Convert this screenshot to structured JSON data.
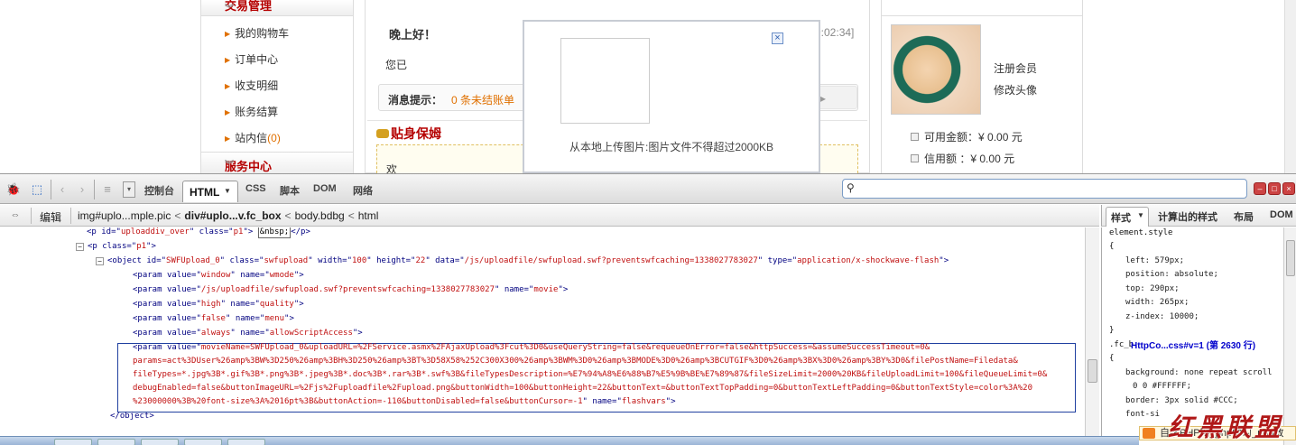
{
  "page": {
    "left_menu": {
      "section_title": "交易管理",
      "items": [
        {
          "label": "我的购物车"
        },
        {
          "label": "订单中心"
        },
        {
          "label": "收支明细"
        },
        {
          "label": "账务结算"
        },
        {
          "label": "站内信",
          "count": "(0)"
        }
      ],
      "service_title": "服务中心"
    },
    "center": {
      "greeting": "晚上好！",
      "time": "9:02:34]",
      "uploaded_text": "您已",
      "notice_label": "消息提示：",
      "notice_value": "0 条未结账单",
      "nanny_title": "贴身保姆",
      "nanny_text": "欢"
    },
    "right_panel": {
      "register_link": "注册会员",
      "edit_avatar_link": "修改头像",
      "available_label": "可用金额：",
      "available_value": "¥ 0.00 元",
      "credit_label": "信用额",
      "credit_sep": "：",
      "credit_value": "¥ 0.00 元"
    },
    "popup": {
      "hint": "从本地上传图片:图片文件不得超过2000KB",
      "close_icon": "close-icon"
    }
  },
  "devtools": {
    "tabs": [
      "控制台",
      "HTML",
      "CSS",
      "脚本",
      "DOM",
      "网络"
    ],
    "edit_label": "编辑",
    "breadcrumbs": [
      "img#uplo...mple.pic",
      "div#uplo...v.fc_box",
      "body.bdbg",
      "html"
    ],
    "side_tabs": [
      "样式",
      "计算出的样式",
      "布局",
      "DOM"
    ],
    "html_lines": {
      "l1_id": "uploaddiv_over",
      "l1_class": "p1",
      "l1_text": "&nbsp;",
      "l2_class": "p1",
      "obj_id": "SWFUpload_0",
      "obj_class": "swfupload",
      "obj_width": "100",
      "obj_height": "22",
      "obj_data": "/js/uploadfile/swfupload.swf?preventswfcaching=1338027783027",
      "obj_type": "application/x-shockwave-flash",
      "p1_value": "window",
      "p1_name": "wmode",
      "p2_value": "/js/uploadfile/swfupload.swf?preventswfcaching=1338027783027",
      "p2_name": "movie",
      "p3_value": "high",
      "p3_name": "quality",
      "p4_value": "false",
      "p4_name": "menu",
      "p5_value": "always",
      "p5_name": "allowScriptAccess",
      "p6_value_1": "movieName=SWFUpload_0&uploadURL=%2FService.asmx%2FAjaxUpload%3Fcut%3D0&useQueryString=false&requeueOnError=false&httpSuccess=&assumeSuccessTimeout=0&",
      "p6_value_2": "params=act%3DUser%26amp%3BW%3D250%26amp%3BH%3D250%26amp%3BT%3D58X58%252C300X300%26amp%3BWM%3D0%26amp%3BMODE%3D0%26amp%3BCUTGIF%3D0%26amp%3BX%3D0%26amp%3BY%3D0&filePostName=Filedata&",
      "p6_value_3": "fileTypes=*.jpg%3B*.gif%3B*.png%3B*.jpeg%3B*.doc%3B*.rar%3B*.swf%3B&fileTypesDescription=%E7%94%A8%E6%88%B7%E5%9B%BE%E7%89%87&fileSizeLimit=2000%20KB&fileUploadLimit=100&fileQueueLimit=0&",
      "p6_value_4": "debugEnabled=false&buttonImageURL=%2Fjs%2Fuploadfile%2Fupload.png&buttonWidth=100&buttonHeight=22&buttonText=&buttonTextTopPadding=0&buttonTextLeftPadding=0&buttonTextStyle=color%3A%20",
      "p6_value_5": "%23000000%3B%20font-size%3A%2016pt%3B&buttonAction=-110&buttonDisabled=false&buttonCursor=-1",
      "p6_name": "flashvars",
      "close_obj": "</object>"
    },
    "css": {
      "rule1_selector": "element.style",
      "open": "{",
      "close": "}",
      "props": [
        "left: 579px;",
        "position: absolute;",
        "top: 290px;",
        "width: 265px;",
        "z-index: 10000;"
      ],
      "rule2_selector": ".fc_b",
      "rule2_link": "HttpCo...css#v=1 (第 2630 行)",
      "rule2_props": [
        "background: none repeat scroll",
        "0 0 #FFFFFF;",
        "border: 3px solid #CCC;",
        "font-si"
      ]
    }
  },
  "watermark": {
    "big": "红黑联盟",
    "small": "自学PHP网_php学习_php教"
  }
}
